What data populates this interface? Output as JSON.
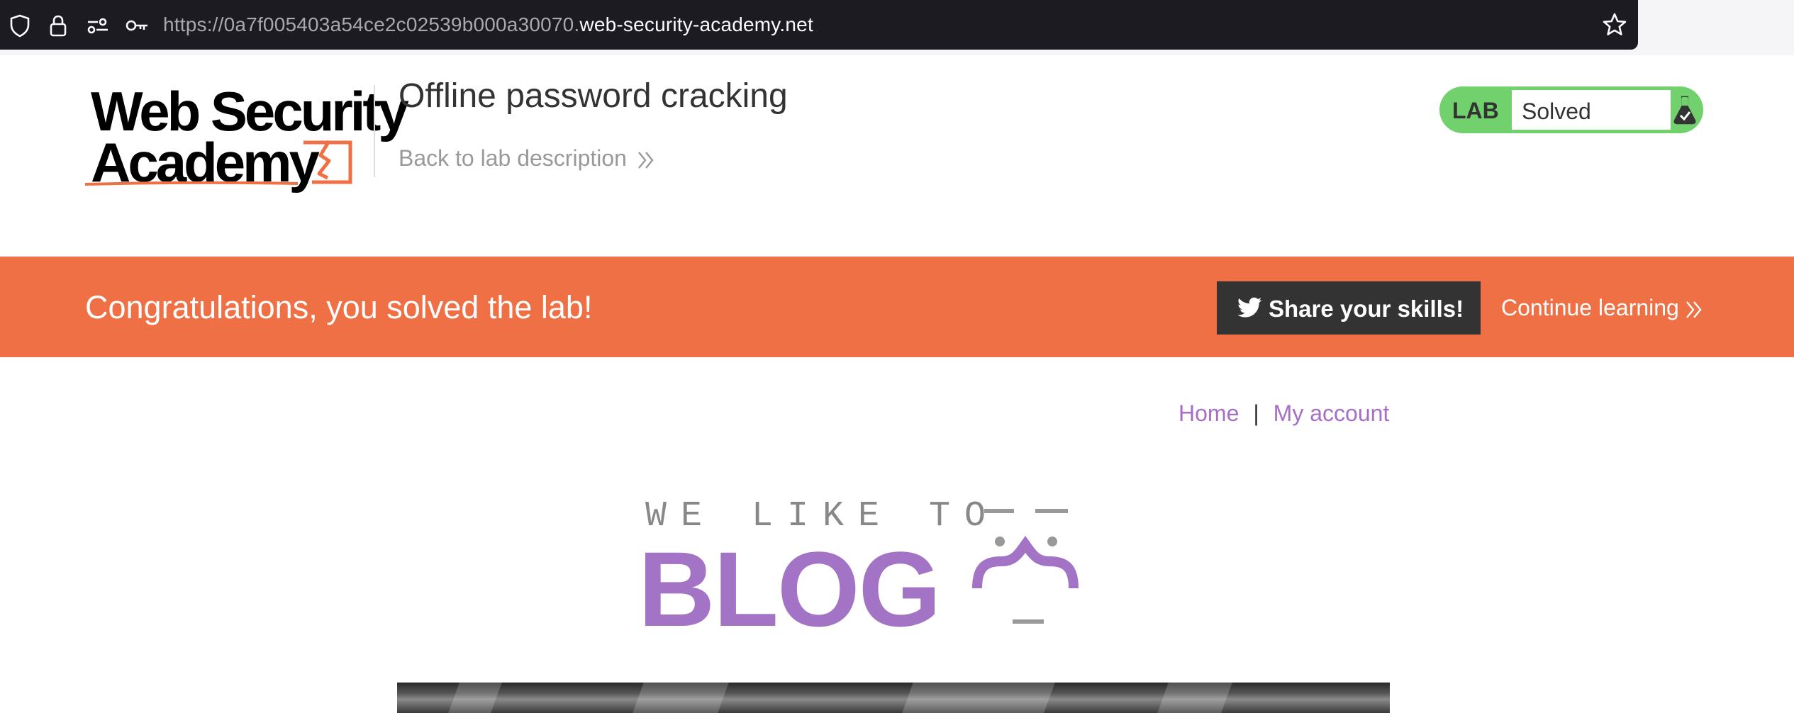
{
  "browser": {
    "url_prefix": "https://0a7f005403a54ce2c02539b000a30070.",
    "url_domain": "web-security-academy.net",
    "icons": [
      "shield-icon",
      "lock-icon",
      "permissions-icon",
      "key-icon",
      "bookmark-star-icon"
    ]
  },
  "academy_header": {
    "logo_line1": "Web Security",
    "logo_line2": "Academy",
    "lab_title": "Offline password cracking",
    "back_link": "Back to lab description"
  },
  "lab_status": {
    "label": "LAB",
    "value": "Solved",
    "icon": "flask-icon"
  },
  "banner": {
    "message": "Congratulations, you solved the lab!",
    "share_label": "Share your skills!",
    "share_icon": "twitter-icon",
    "continue_label": "Continue learning"
  },
  "blog_nav": {
    "home": "Home",
    "separator": "|",
    "my_account": "My account"
  },
  "blog_logo": {
    "tagline": "WE LIKE TO",
    "word": "BLOG"
  },
  "colors": {
    "banner": "#ee7044",
    "lab_solved": "#70d16d",
    "accent_purple": "#a66fc6",
    "share_button": "#333333",
    "url_bar": "#1c1b22"
  }
}
